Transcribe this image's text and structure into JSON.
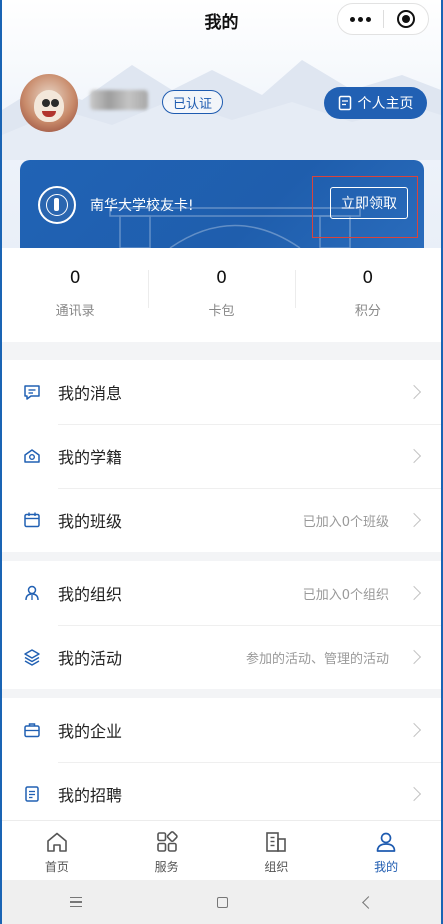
{
  "nav": {
    "title": "我的"
  },
  "profile": {
    "verified_label": "已认证",
    "homepage_label": "个人主页"
  },
  "campus_card": {
    "text": "南华大学校友卡!",
    "claim_label": "立即领取"
  },
  "stats": [
    {
      "value": "0",
      "label": "通讯录"
    },
    {
      "value": "0",
      "label": "卡包"
    },
    {
      "value": "0",
      "label": "积分"
    }
  ],
  "menu_groups": [
    [
      {
        "label": "我的消息",
        "right": "",
        "icon": "message-icon"
      },
      {
        "label": "我的学籍",
        "right": "",
        "icon": "student-status-icon"
      },
      {
        "label": "我的班级",
        "right": "已加入0个班级",
        "icon": "calendar-icon"
      }
    ],
    [
      {
        "label": "我的组织",
        "right": "已加入0个组织",
        "icon": "organization-icon"
      },
      {
        "label": "我的活动",
        "right": "参加的活动、管理的活动",
        "icon": "layers-icon"
      }
    ],
    [
      {
        "label": "我的企业",
        "right": "",
        "icon": "briefcase-icon"
      },
      {
        "label": "我的招聘",
        "right": "",
        "icon": "document-icon"
      }
    ]
  ],
  "tabbar": [
    {
      "label": "首页",
      "icon": "home-icon",
      "active": false
    },
    {
      "label": "服务",
      "icon": "grid-icon",
      "active": false
    },
    {
      "label": "组织",
      "icon": "building-icon",
      "active": false
    },
    {
      "label": "我的",
      "icon": "person-icon",
      "active": true
    }
  ],
  "colors": {
    "brand": "#2160b3",
    "active_tab": "#1e5bb0",
    "highlight_box": "#d9443c"
  }
}
